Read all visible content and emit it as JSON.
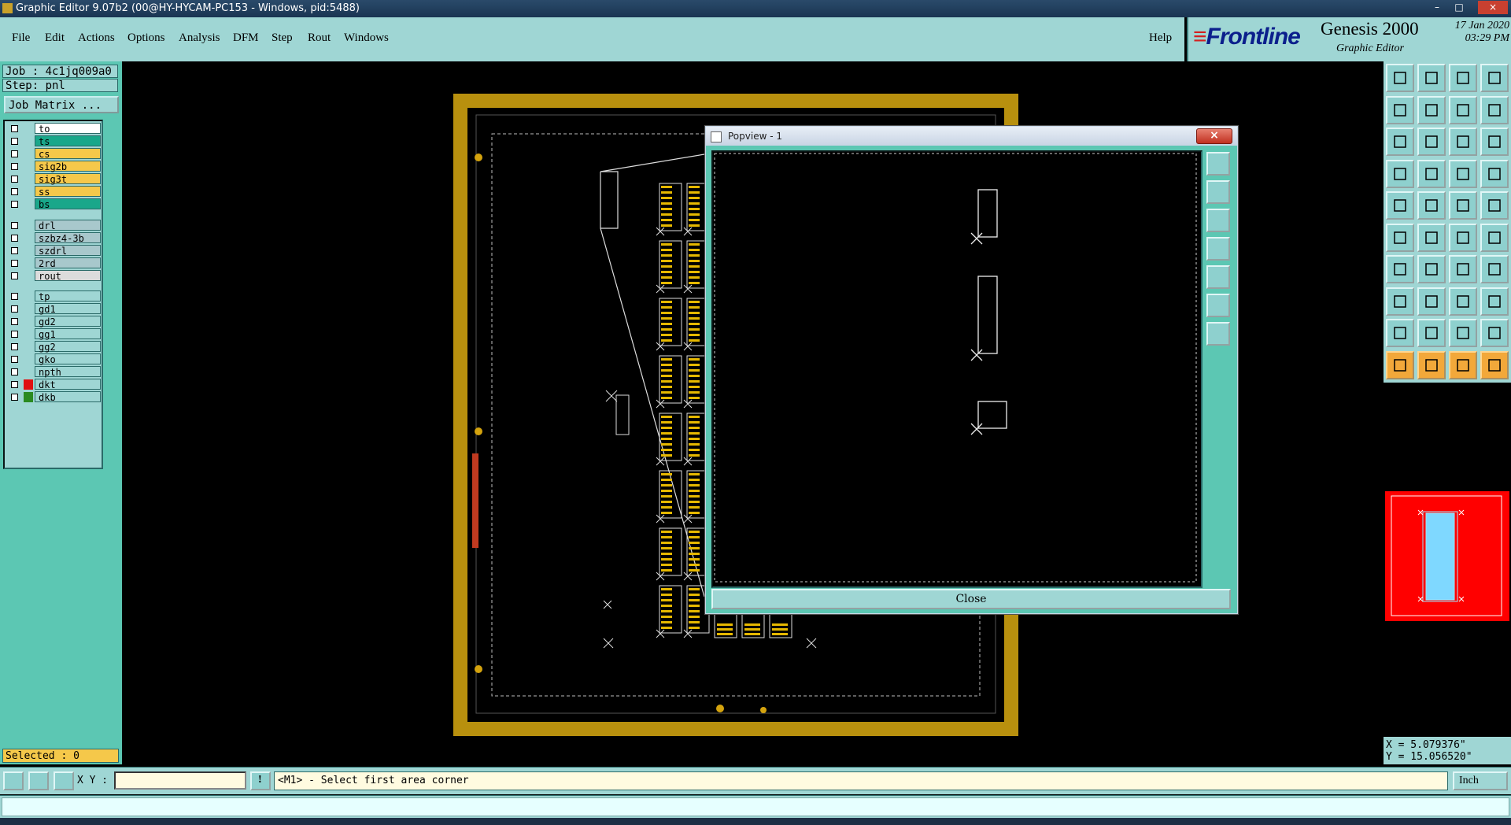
{
  "window": {
    "title": "Graphic Editor 9.07b2 (00@HY-HYCAM-PC153 - Windows, pid:5488)",
    "controls": [
      "–",
      "□",
      "×"
    ]
  },
  "menu": {
    "items": [
      "File",
      "Edit",
      "Actions",
      "Options",
      "Analysis",
      "DFM",
      "Step",
      "Rout",
      "Windows"
    ],
    "help": "Help"
  },
  "brand": {
    "logo_prefix": "Front",
    "logo_suffix": "line",
    "product": "Genesis 2000",
    "subtitle": "Graphic Editor",
    "date": "17 Jan 2020",
    "time": "03:29 PM"
  },
  "job": {
    "job_line": "Job : 4c1jq009a0",
    "step_line": "Step: pnl",
    "matrix_button": "Job Matrix ..."
  },
  "layers": [
    {
      "name": "to",
      "color": "#ffffff",
      "marker": ""
    },
    {
      "name": "ts",
      "color": "#19a78a",
      "marker": ""
    },
    {
      "name": "cs",
      "color": "#f5c84a",
      "marker": ""
    },
    {
      "name": "sig2b",
      "color": "#f5c84a",
      "marker": ""
    },
    {
      "name": "sig3t",
      "color": "#f5c84a",
      "marker": ""
    },
    {
      "name": "ss",
      "color": "#f5c84a",
      "marker": ""
    },
    {
      "name": "bs",
      "color": "#19a78a",
      "marker": ""
    },
    {
      "name": "drl",
      "color": "#a8c8cc",
      "marker": ""
    },
    {
      "name": "szbz4-3b",
      "color": "#a8c8cc",
      "marker": ""
    },
    {
      "name": "szdrl",
      "color": "#a8c8cc",
      "marker": ""
    },
    {
      "name": "2rd",
      "color": "#a8c8cc",
      "marker": ""
    },
    {
      "name": "rout",
      "color": "#dcdcdc",
      "marker": ""
    },
    {
      "name": "tp",
      "color": "#9fd6d4",
      "marker": ""
    },
    {
      "name": "gd1",
      "color": "#9fd6d4",
      "marker": ""
    },
    {
      "name": "gd2",
      "color": "#9fd6d4",
      "marker": ""
    },
    {
      "name": "gg1",
      "color": "#9fd6d4",
      "marker": ""
    },
    {
      "name": "gg2",
      "color": "#9fd6d4",
      "marker": ""
    },
    {
      "name": "gko",
      "color": "#9fd6d4",
      "marker": ""
    },
    {
      "name": "npth",
      "color": "#9fd6d4",
      "marker": ""
    },
    {
      "name": "dkt",
      "color": "#9fd6d4",
      "marker": "red"
    },
    {
      "name": "dkb",
      "color": "#9fd6d4",
      "marker": "green"
    }
  ],
  "selected": "Selected : 0",
  "popview": {
    "title": "Popview - 1",
    "close_label": "Close"
  },
  "status": {
    "xy_label": "X Y :",
    "xy_value": "",
    "prompt": "<M1> - Select first area corner",
    "unit": "Inch"
  },
  "coords": {
    "x": "X = 5.079376\"",
    "y": "Y = 15.056520\""
  },
  "colors": {
    "panel": "#9fd6d4",
    "panel_dark": "#5cc7b3",
    "board": "#b8900e",
    "feature": "#e6b800",
    "minimap": "#ff0000"
  }
}
